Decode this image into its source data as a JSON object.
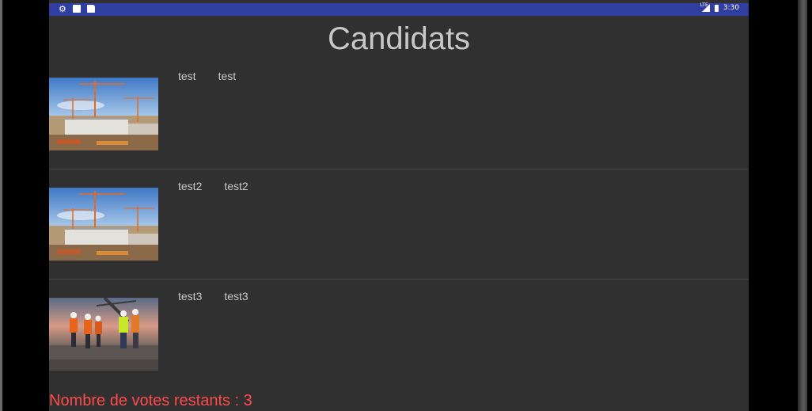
{
  "status_bar": {
    "time": "3:30",
    "network": "LTE"
  },
  "page": {
    "title": "Candidats"
  },
  "candidates": [
    {
      "first": "test",
      "second": "test"
    },
    {
      "first": "test2",
      "second": "test2"
    },
    {
      "first": "test3",
      "second": "test3"
    }
  ],
  "footer": {
    "votes_remaining": "Nombre de votes restants : 3"
  },
  "colors": {
    "status_bar": "#303f9f",
    "background": "#303030",
    "text": "#c8c8c8",
    "footer_text": "#ff4a4a"
  }
}
